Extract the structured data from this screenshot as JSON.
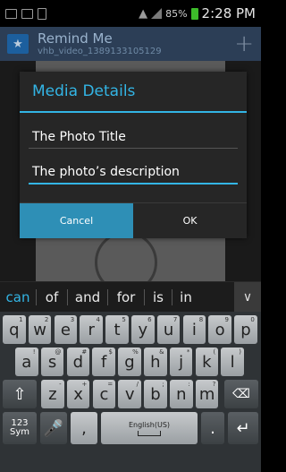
{
  "status_bar": {
    "battery_percent": "85%",
    "time": "2:28 PM"
  },
  "action_bar": {
    "title": "Remind Me",
    "subtitle": "vhb_video_1389133105129",
    "add_symbol": "+"
  },
  "dialog": {
    "title": "Media Details",
    "title_field_value": "The Photo Title",
    "description_field_value": "The photo’s description",
    "cancel_label": "Cancel",
    "ok_label": "OK"
  },
  "suggestions": [
    "can",
    "of",
    "and",
    "for",
    "is",
    "in"
  ],
  "keyboard": {
    "row1": [
      [
        "q",
        "1"
      ],
      [
        "w",
        "2"
      ],
      [
        "e",
        "3"
      ],
      [
        "r",
        "4"
      ],
      [
        "t",
        "5"
      ],
      [
        "y",
        "6"
      ],
      [
        "u",
        "7"
      ],
      [
        "i",
        "8"
      ],
      [
        "o",
        "9"
      ],
      [
        "p",
        "0"
      ]
    ],
    "row2": [
      [
        "a",
        "!"
      ],
      [
        "s",
        "@"
      ],
      [
        "d",
        "#"
      ],
      [
        "f",
        "$"
      ],
      [
        "g",
        "%"
      ],
      [
        "h",
        "&"
      ],
      [
        "j",
        "*"
      ],
      [
        "k",
        "("
      ],
      [
        "l",
        ")"
      ]
    ],
    "row3": [
      [
        "z",
        "-"
      ],
      [
        "x",
        "+"
      ],
      [
        "c",
        "="
      ],
      [
        "v",
        "/"
      ],
      [
        "b",
        ";"
      ],
      [
        "n",
        ":"
      ],
      [
        "m",
        "?"
      ]
    ],
    "symbols_label_1": "123",
    "symbols_label_2": "Sym",
    "comma": ",",
    "space_label": "English(US)",
    "period": "."
  },
  "colors": {
    "accent": "#33b5e5",
    "cancel_button": "#2e8fb6",
    "action_bar": "#2c3e56"
  }
}
